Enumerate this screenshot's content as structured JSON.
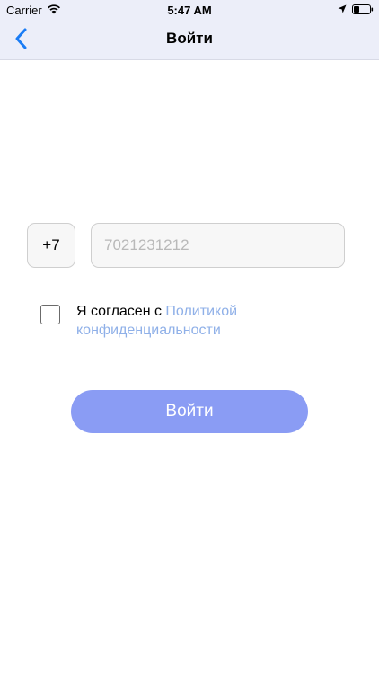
{
  "status_bar": {
    "carrier": "Carrier",
    "time": "5:47 AM",
    "icons": [
      "wifi-icon",
      "location-icon",
      "battery-icon"
    ]
  },
  "nav": {
    "back_icon": "chevron-left-icon",
    "title": "Войти"
  },
  "phone": {
    "country_code": "+7",
    "placeholder": "7021231212",
    "value": ""
  },
  "agreement": {
    "checked": false,
    "text": "Я согласен с ",
    "link_text": "Политикой конфиденциальности"
  },
  "login_button": {
    "label": "Войти"
  },
  "colors": {
    "header_bg": "#eceef9",
    "accent_blue": "#1a7cf5",
    "link": "#8fb0e8",
    "button_bg": "#8a9cf4"
  }
}
